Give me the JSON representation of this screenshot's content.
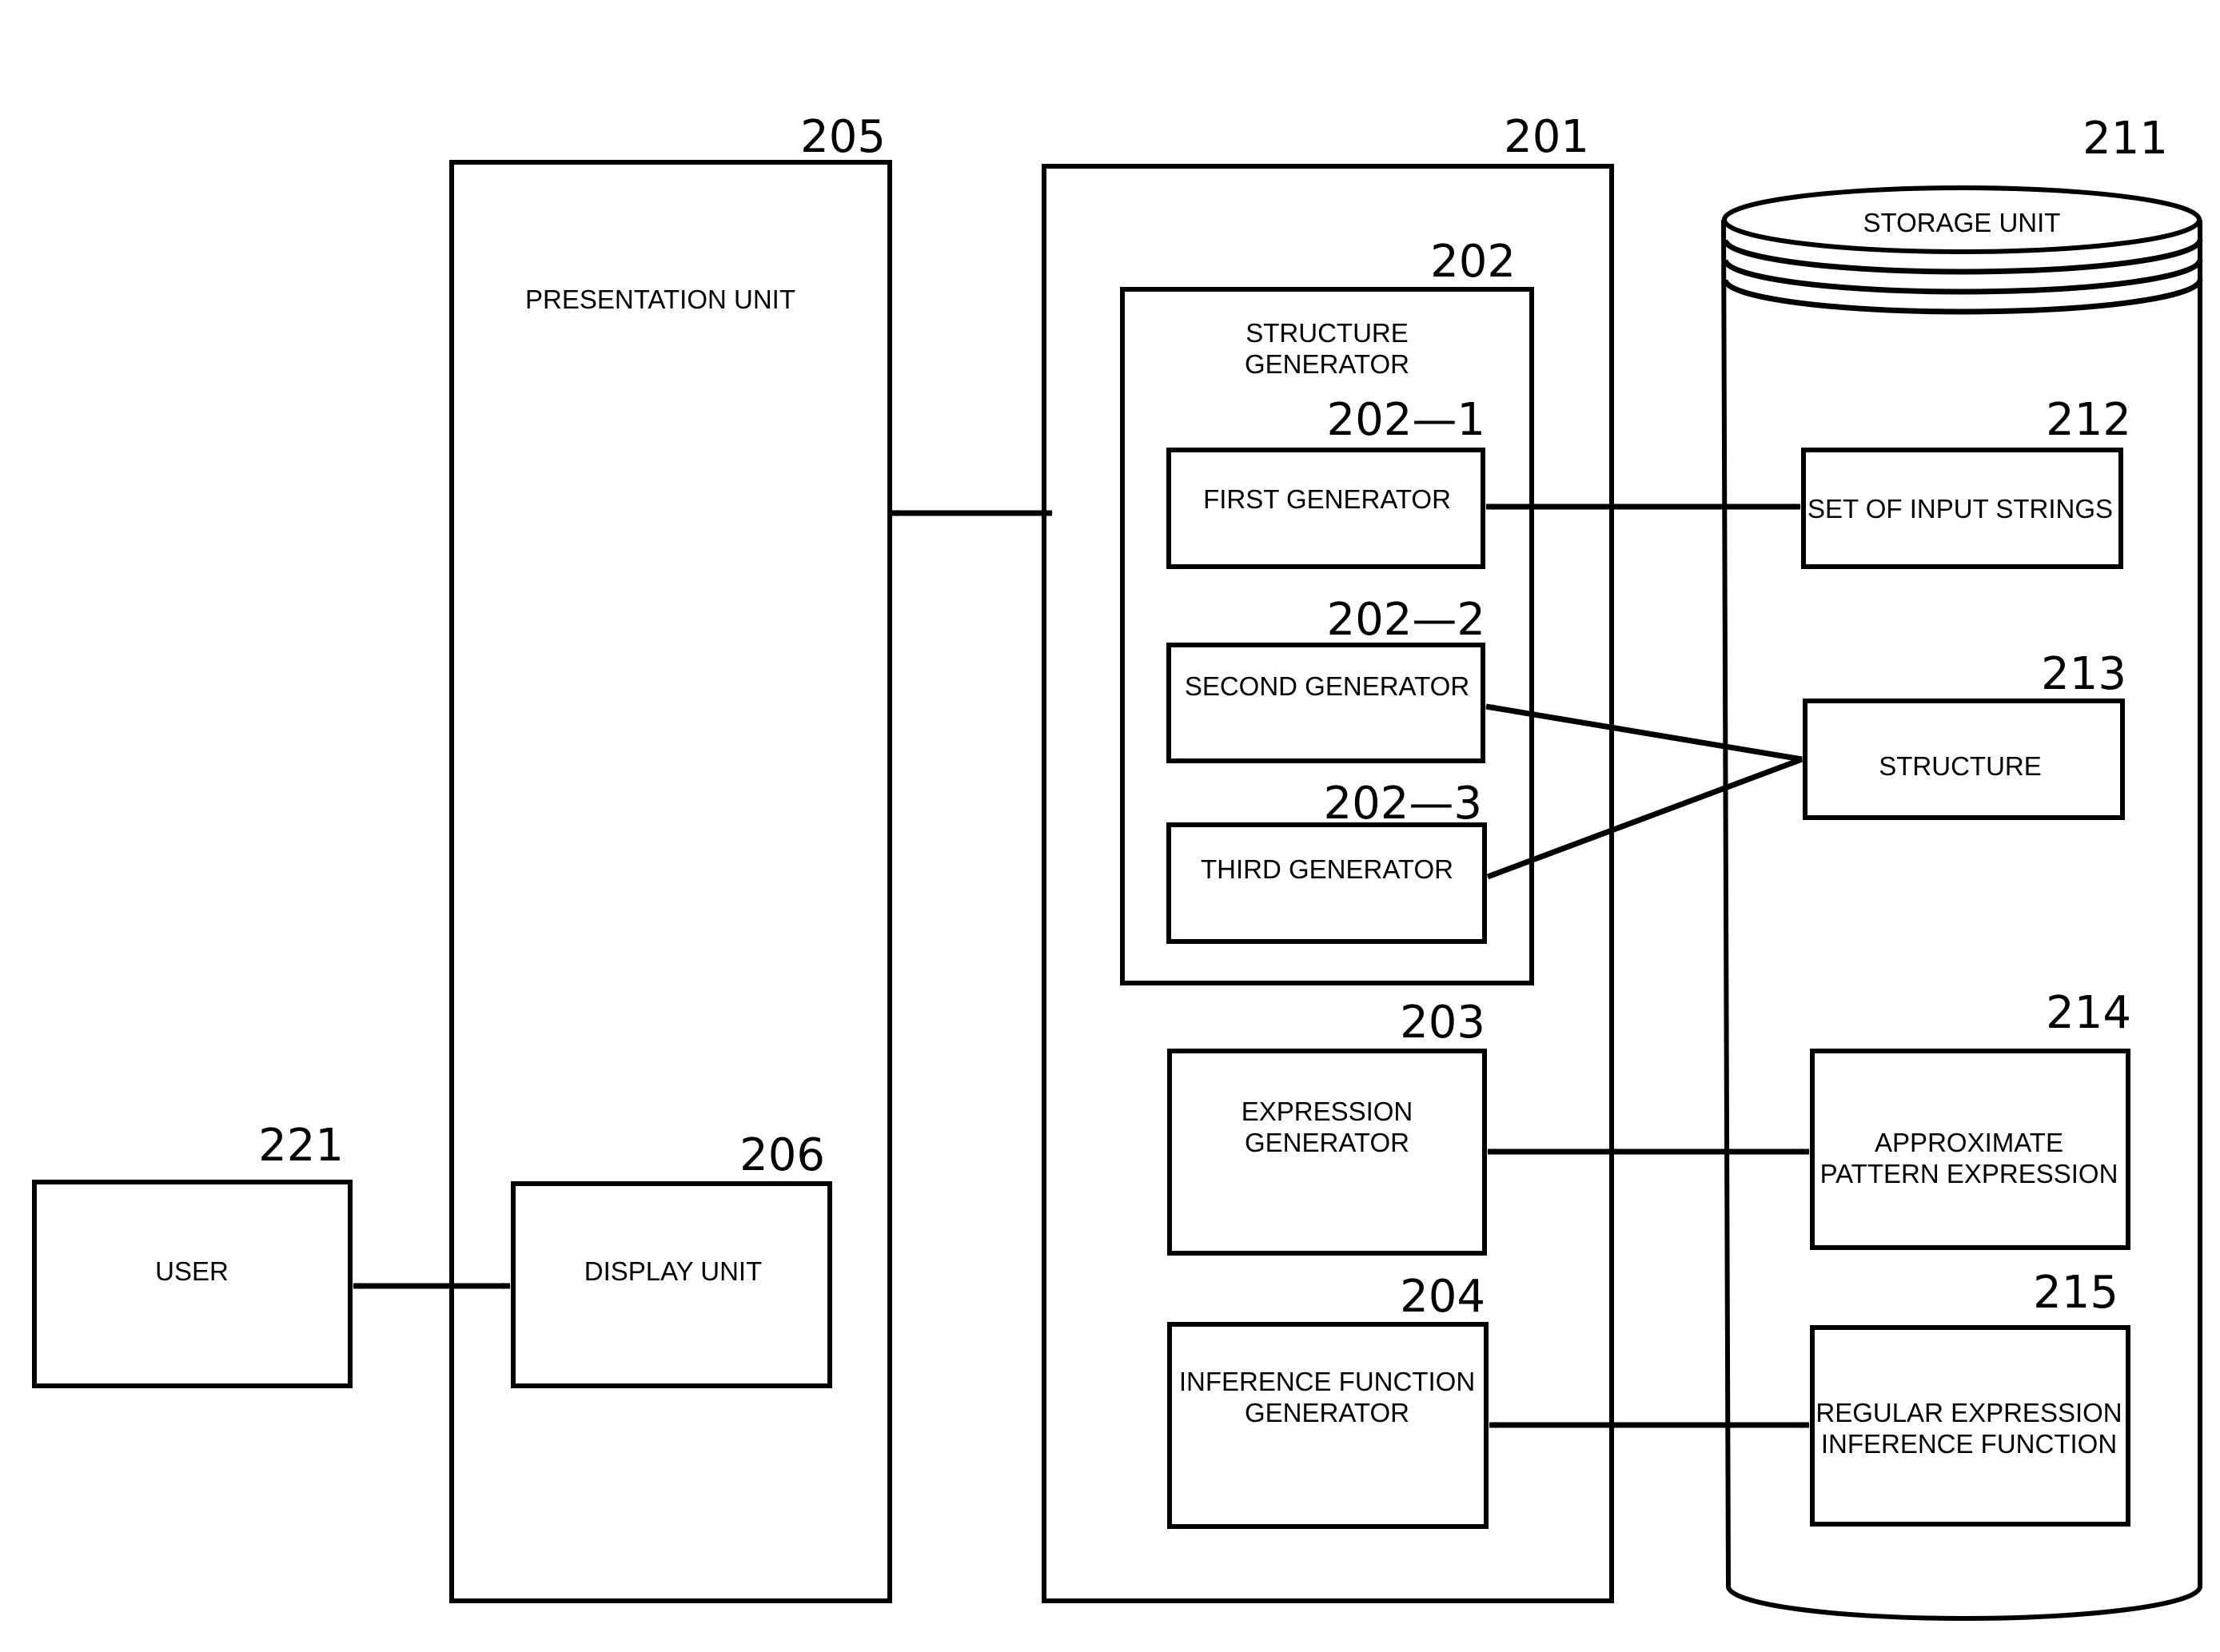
{
  "diagram": {
    "nodes": {
      "presentation_unit": {
        "ref": "205",
        "label": [
          "PRESENTATION UNIT"
        ]
      },
      "processing_unit": {
        "ref": "201"
      },
      "structure_generator": {
        "ref": "202",
        "label": [
          "STRUCTURE",
          "GENERATOR"
        ]
      },
      "first_generator": {
        "ref": "202—1",
        "label": [
          "FIRST GENERATOR"
        ]
      },
      "second_generator": {
        "ref": "202—2",
        "label": [
          "SECOND GENERATOR"
        ]
      },
      "third_generator": {
        "ref": "202—3",
        "label": [
          "THIRD GENERATOR"
        ]
      },
      "expression_generator": {
        "ref": "203",
        "label": [
          "EXPRESSION",
          "GENERATOR"
        ]
      },
      "inference_function_generator": {
        "ref": "204",
        "label": [
          "INFERENCE FUNCTION",
          "GENERATOR"
        ]
      },
      "storage_unit": {
        "ref": "211",
        "label": [
          "STORAGE UNIT"
        ]
      },
      "set_of_input_strings": {
        "ref": "212",
        "label": [
          "SET OF INPUT STRINGS"
        ]
      },
      "structure": {
        "ref": "213",
        "label": [
          "STRUCTURE"
        ]
      },
      "approximate_pattern_expression": {
        "ref": "214",
        "label": [
          "APPROXIMATE",
          "PATTERN EXPRESSION"
        ]
      },
      "regular_expression_inference_function": {
        "ref": "215",
        "label": [
          "REGULAR EXPRESSION",
          "INFERENCE FUNCTION"
        ]
      },
      "user": {
        "ref": "221",
        "label": [
          "USER"
        ]
      },
      "display_unit": {
        "ref": "206",
        "label": [
          "DISPLAY UNIT"
        ]
      }
    },
    "edges": [
      {
        "from": "presentation_unit",
        "to": "processing_unit",
        "type": "bidirectional"
      },
      {
        "from": "first_generator",
        "to": "set_of_input_strings",
        "type": "bidirectional"
      },
      {
        "from": "second_generator",
        "to": "structure",
        "type": "bidirectional"
      },
      {
        "from": "third_generator",
        "to": "structure",
        "type": "bidirectional"
      },
      {
        "from": "expression_generator",
        "to": "approximate_pattern_expression",
        "type": "bidirectional"
      },
      {
        "from": "inference_function_generator",
        "to": "regular_expression_inference_function",
        "type": "bidirectional"
      },
      {
        "from": "user",
        "to": "display_unit",
        "type": "bidirectional"
      }
    ]
  }
}
